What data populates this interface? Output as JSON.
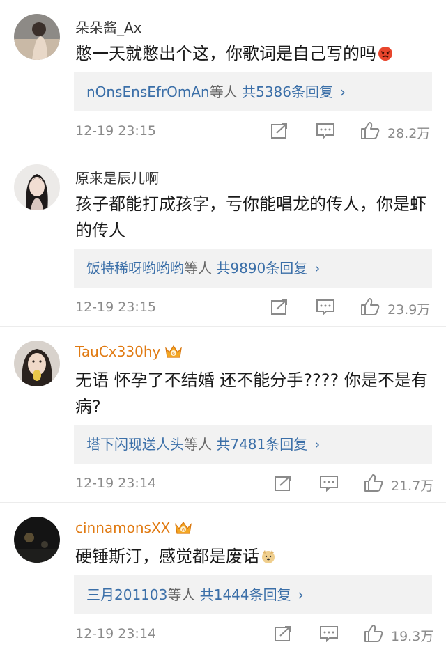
{
  "comments": [
    {
      "user": "朵朵酱_Ax",
      "vip": false,
      "text": "憋一天就憋出个这，你歌词是自己写的吗",
      "emoji": "angry-face-emoji",
      "reply_names": "nOnsEnsEfrOmAn",
      "reply_mid": "等人",
      "reply_count": "共5386条回复",
      "time": "12-19 23:15",
      "likes": "28.2万"
    },
    {
      "user": "原来是辰儿啊",
      "vip": false,
      "text": "孩子都能打成孩字，亏你能唱龙的传人，你是虾的传人",
      "reply_names": "饭特稀呀哟哟哟",
      "reply_mid": "等人",
      "reply_count": "共9890条回复",
      "time": "12-19 23:15",
      "likes": "23.9万"
    },
    {
      "user": "TauCx330hy",
      "vip": true,
      "vip_level": "6",
      "text": "无语 怀孕了不结婚 还不能分手???? 你是不是有病?",
      "reply_names": "塔下闪现送人头",
      "reply_mid": "等人",
      "reply_count": "共7481条回复",
      "time": "12-19 23:14",
      "likes": "21.7万"
    },
    {
      "user": "cinnamonsXX",
      "vip": true,
      "vip_level": "6",
      "text": "硬锤斯汀，感觉都是废话",
      "emoji": "doge-emoji",
      "reply_names": "三月201103",
      "reply_mid": "等人",
      "reply_count": "共1444条回复",
      "time": "12-19 23:14",
      "likes": "19.3万"
    }
  ],
  "colors": {
    "vip_name": "#e07a12",
    "reply_link": "#3b6fa8",
    "meta": "#8a8a8a"
  }
}
